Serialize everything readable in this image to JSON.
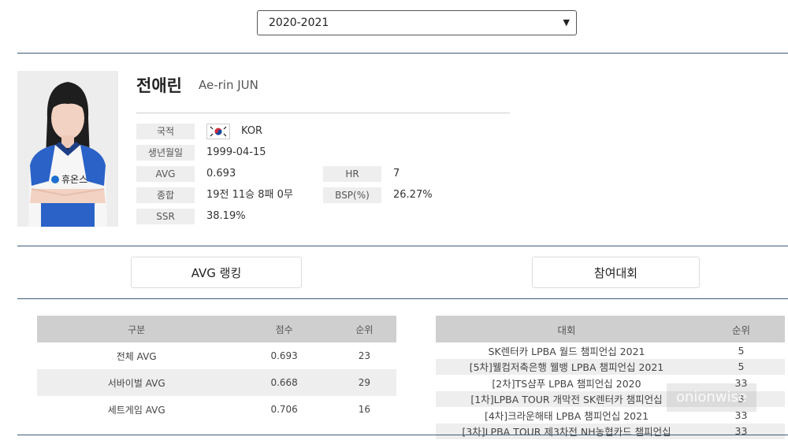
{
  "season": {
    "selected": "2020-2021"
  },
  "player": {
    "name_ko": "전애린",
    "name_en": "Ae-rin JUN",
    "sponsor": "휴온스",
    "fields": [
      {
        "label": "국적",
        "value": "KOR"
      },
      {
        "label": "생년월일",
        "value": "1999-04-15"
      },
      {
        "label": "AVG",
        "value": "0.693"
      },
      {
        "label": "종합",
        "value": "19전 11승 8패 0무"
      },
      {
        "label": "SSR",
        "value": "38.19%"
      }
    ],
    "fields_right": [
      {
        "label": "HR",
        "value": "7"
      },
      {
        "label": "BSP(%)",
        "value": "26.27%"
      }
    ]
  },
  "tabs": {
    "avg_ranking": "AVG 랭킹",
    "tournaments": "참여대회"
  },
  "ranking": {
    "headers": [
      "구분",
      "점수",
      "순위"
    ],
    "rows": [
      [
        "전체 AVG",
        "0.693",
        "23"
      ],
      [
        "서바이벌 AVG",
        "0.668",
        "29"
      ],
      [
        "세트게임 AVG",
        "0.706",
        "16"
      ]
    ]
  },
  "tournaments": {
    "headers": [
      "대회",
      "순위"
    ],
    "rows": [
      [
        "SK렌터카 LPBA 월드 챔피언십 2021",
        "5"
      ],
      [
        "[5차]웰컴저축은행 웰뱅 LPBA 챔피언십 2021",
        "5"
      ],
      [
        "[2차]TS샴푸 LPBA 챔피언십 2020",
        "33"
      ],
      [
        "[1차]LPBA TOUR 개막전 SK렌터카 챔피언십",
        "3"
      ],
      [
        "[4차]크라운해태 LPBA 챔피언십 2021",
        "33"
      ],
      [
        "[3차]LPBA TOUR 제3차전 NH농협카드 챔피언십",
        "33"
      ]
    ]
  },
  "watermark": "onionwise",
  "colors": {
    "rule": "#3b5d7a",
    "header_bg": "#cfcfcf",
    "row_alt": "#eeeeee",
    "jersey_blue": "#2a62c7"
  },
  "icons": [
    "chevron-down-icon",
    "korea-flag-icon",
    "player-photo"
  ]
}
